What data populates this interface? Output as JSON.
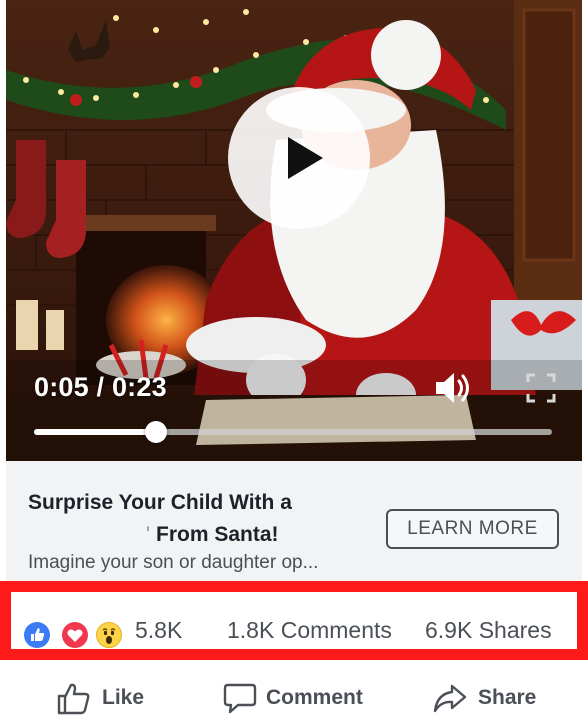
{
  "video": {
    "time_display": "0:05 / 0:23",
    "progress": 0.235
  },
  "link_preview": {
    "headline_line1": "Surprise Your Child With a",
    "headline_tick": "'",
    "headline_line2": "From Santa!",
    "description": "Imagine your son or daughter op...",
    "cta_label": "LEARN MORE"
  },
  "reactions": {
    "icons": [
      "like-icon",
      "love-icon",
      "wow-icon"
    ],
    "total": "5.8K",
    "comments": "1.8K Comments",
    "shares": "6.9K Shares"
  },
  "actions": {
    "like_label": "Like",
    "comment_label": "Comment",
    "share_label": "Share"
  },
  "colors": {
    "highlight": "#ff1a1a",
    "like_blue": "#3b7bf5",
    "love_red": "#f0384f",
    "wow_yellow": "#ffd349"
  }
}
